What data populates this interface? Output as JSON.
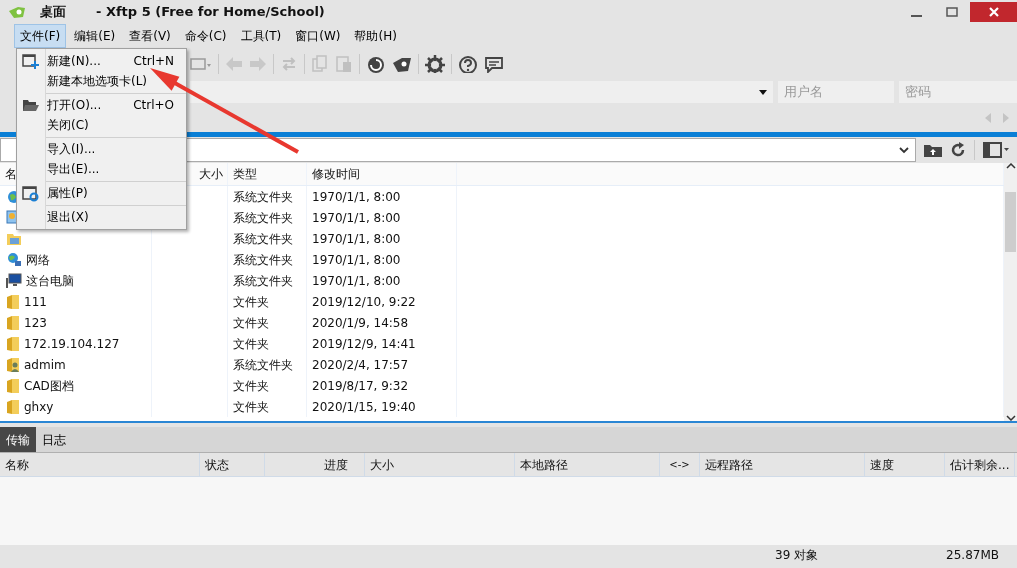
{
  "window": {
    "path": "桌面",
    "title": "- Xftp 5 (Free for Home/School)"
  },
  "menu_bar": [
    {
      "label": "文件(F)",
      "selected": true
    },
    {
      "label": "编辑(E)",
      "selected": false
    },
    {
      "label": "查看(V)",
      "selected": false
    },
    {
      "label": "命令(C)",
      "selected": false
    },
    {
      "label": "工具(T)",
      "selected": false
    },
    {
      "label": "窗口(W)",
      "selected": false
    },
    {
      "label": "帮助(H)",
      "selected": false
    }
  ],
  "file_menu": [
    {
      "kind": "item",
      "label": "新建(N)...",
      "shortcut": "Ctrl+N",
      "has_icon": true
    },
    {
      "kind": "item",
      "label": "新建本地选项卡(L)",
      "has_icon": false
    },
    {
      "kind": "separator"
    },
    {
      "kind": "item",
      "label": "打开(O)...",
      "shortcut": "Ctrl+O",
      "has_icon": true
    },
    {
      "kind": "item",
      "label": "关闭(C)",
      "has_icon": false
    },
    {
      "kind": "separator"
    },
    {
      "kind": "item",
      "label": "导入(I)...",
      "has_icon": false
    },
    {
      "kind": "item",
      "label": "导出(E)...",
      "has_icon": false
    },
    {
      "kind": "separator"
    },
    {
      "kind": "item",
      "label": "属性(P)",
      "has_icon": true
    },
    {
      "kind": "separator"
    },
    {
      "kind": "item",
      "label": "退出(X)",
      "has_icon": false
    }
  ],
  "address_bar": {
    "username_placeholder": "用户名",
    "password_placeholder": "密码"
  },
  "file_list": {
    "columns": [
      "名",
      "大小",
      "类型",
      "修改时间"
    ],
    "rows": [
      {
        "kind": "system",
        "type": "系统文件夹",
        "modified": "1970/1/1, 8:00"
      },
      {
        "kind": "system",
        "type": "系统文件夹",
        "modified": "1970/1/1, 8:00"
      },
      {
        "kind": "system",
        "type": "系统文件夹",
        "modified": "1970/1/1, 8:00"
      },
      {
        "kind": "system",
        "name": "网络",
        "type": "系统文件夹",
        "modified": "1970/1/1, 8:00"
      },
      {
        "kind": "system",
        "name": "这台电脑",
        "type": "系统文件夹",
        "modified": "1970/1/1, 8:00"
      },
      {
        "kind": "folder",
        "name": "111",
        "type": "文件夹",
        "modified": "2019/12/10, 9:22"
      },
      {
        "kind": "folder",
        "name": "123",
        "type": "文件夹",
        "modified": "2020/1/9, 14:58"
      },
      {
        "kind": "folder",
        "name": "172.19.104.127",
        "type": "文件夹",
        "modified": "2019/12/9, 14:41"
      },
      {
        "kind": "user",
        "name": "admim",
        "type": "系统文件夹",
        "modified": "2020/2/4, 17:57"
      },
      {
        "kind": "folder",
        "name": "CAD图档",
        "type": "文件夹",
        "modified": "2019/8/17, 9:32"
      },
      {
        "kind": "folder",
        "name": "ghxy",
        "type": "文件夹",
        "modified": "2020/1/15, 19:40"
      }
    ]
  },
  "transfer_tabs": [
    {
      "label": "传输",
      "selected": true
    },
    {
      "label": "日志",
      "selected": false
    }
  ],
  "transfer_columns": [
    "名称",
    "状态",
    "进度",
    "大小",
    "本地路径",
    "<->",
    "远程路径",
    "速度",
    "估计剩余..."
  ],
  "status_bar": {
    "objects": "39 对象",
    "size": "25.87MB"
  }
}
